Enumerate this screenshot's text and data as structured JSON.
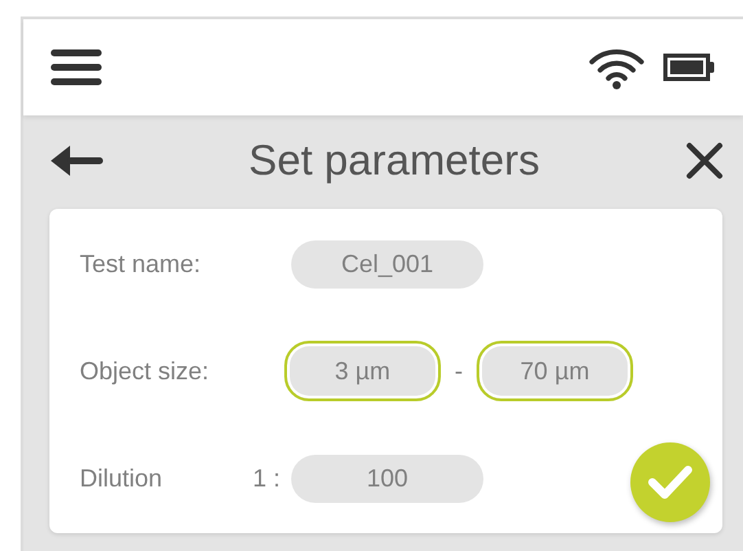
{
  "header": {
    "title": "Set parameters"
  },
  "form": {
    "rows": [
      {
        "label": "Test name:",
        "fields": [
          {
            "value": "Cel_001",
            "highlighted": false
          }
        ]
      },
      {
        "label": "Object size:",
        "separator": "-",
        "fields": [
          {
            "value": "3 µm",
            "highlighted": true
          },
          {
            "value": "70 µm",
            "highlighted": true
          }
        ]
      },
      {
        "label": "Dilution",
        "prefix": "1 :",
        "fields": [
          {
            "value": "100",
            "highlighted": false
          }
        ]
      }
    ]
  }
}
